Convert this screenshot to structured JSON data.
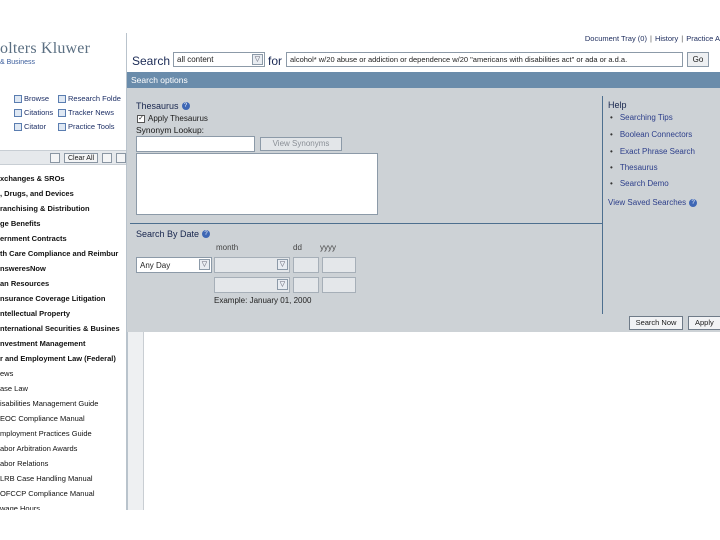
{
  "brand": {
    "logo_text": "olters Kluwer",
    "logo_sub": "& Business"
  },
  "left_nav": {
    "browse": "Browse",
    "research_folder": "Research Folde",
    "citations": "Citations",
    "tracker_news": "Tracker News",
    "citator": "Citator",
    "practice_tools": "Practice Tools",
    "clear_all": "Clear All"
  },
  "libraries": [
    {
      "label": "xchanges & SROs",
      "bold": true
    },
    {
      "label": ", Drugs, and Devices",
      "bold": true
    },
    {
      "label": "ranchising & Distribution",
      "bold": true
    },
    {
      "label": "ge Benefits",
      "bold": true
    },
    {
      "label": "ernment Contracts",
      "bold": true
    },
    {
      "label": "th Care Compliance and Reimbur",
      "bold": true
    },
    {
      "label": "nsweresNow",
      "bold": true
    },
    {
      "label": "an Resources",
      "bold": true
    },
    {
      "label": "nsurance Coverage Litigation",
      "bold": true
    },
    {
      "label": "ntellectual Property",
      "bold": true
    },
    {
      "label": "nternational Securities & Busines",
      "bold": true
    },
    {
      "label": "nvestment Management",
      "bold": true
    },
    {
      "label": "r and Employment Law (Federal)",
      "bold": true
    },
    {
      "label": "ews",
      "bold": false
    },
    {
      "label": "ase Law",
      "bold": false
    },
    {
      "label": "isabilities Management Guide",
      "bold": false
    },
    {
      "label": "EOC Compliance Manual",
      "bold": false
    },
    {
      "label": "mployment Practices Guide",
      "bold": false
    },
    {
      "label": "abor Arbitration Awards",
      "bold": false
    },
    {
      "label": "abor Relations",
      "bold": false
    },
    {
      "label": "LRB Case Handling Manual",
      "bold": false
    },
    {
      "label": "OFCCP Compliance Manual",
      "bold": false
    },
    {
      "label": "wage Hours",
      "bold": false
    }
  ],
  "top_links": {
    "doc_tray": "Document Tray (0)",
    "history": "History",
    "practice": "Practice A"
  },
  "search": {
    "label": "Search",
    "content_value": "all content",
    "for_label": "for",
    "query": "alcohol* w/20 abuse or addiction or dependence w/20 \"americans with disabilities act\" or ada or a.d.a.",
    "go": "Go"
  },
  "options": {
    "bar_title": "Search options",
    "thesaurus_title": "Thesaurus",
    "apply_thesaurus": "Apply Thesaurus",
    "synonym_lookup": "Synonym Lookup:",
    "view_synonyms": "View Synonyms",
    "date_title": "Search By Date",
    "month": "month",
    "dd": "dd",
    "yyyy": "yyyy",
    "date_value": "Any Day",
    "example": "Example: January 01, 2000",
    "help_title": "Help",
    "help_items": [
      "Searching Tips",
      "Boolean Connectors",
      "Exact Phrase Search",
      "Thesaurus",
      "Search Demo"
    ],
    "view_saved": "View Saved Searches",
    "search_now": "Search Now",
    "apply": "Apply"
  },
  "colors": {
    "options_bar": "#6a8cab",
    "panel_bg": "#cdd2d6",
    "link": "#2c3e8a"
  }
}
